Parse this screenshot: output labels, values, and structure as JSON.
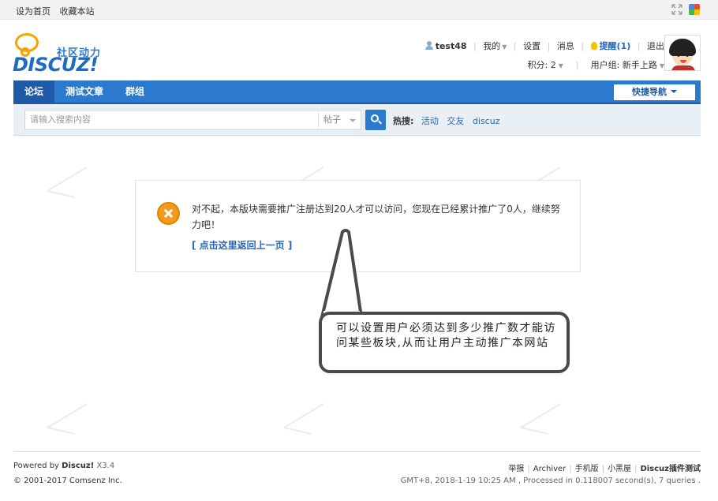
{
  "topbar": {
    "set_home": "设为首页",
    "bookmark": "收藏本站"
  },
  "logo": {
    "tagline": "社区动力",
    "wordmark": "DISCUZ!"
  },
  "user": {
    "name": "test48",
    "mine": "我的",
    "settings": "设置",
    "messages": "消息",
    "remind": "提醒(1)",
    "logout": "退出",
    "points": "积分: 2",
    "group": "用户组: 新手上路"
  },
  "nav": {
    "tabs": [
      "论坛",
      "测试文章",
      "群组"
    ],
    "quick_nav": "快捷导航"
  },
  "search": {
    "placeholder": "请输入搜索内容",
    "type": "帖子",
    "hot_label": "热搜:",
    "hot_keywords": [
      "活动",
      "交友",
      "discuz"
    ]
  },
  "message": {
    "text": "对不起，本版块需要推广注册达到20人才可以访问，您现在已经累计推广了0人，继续努力吧！",
    "back_link": "[ 点击这里返回上一页 ]"
  },
  "callout": {
    "text": "可以设置用户必须达到多少推广数才能访问某些板块,从而让用户主动推广本网站"
  },
  "footer": {
    "powered_prefix": "Powered by",
    "powered_name": "Discuz!",
    "version": "X3.4",
    "copyright": "© 2001-2017 Comsenz Inc.",
    "links": [
      "举报",
      "Archiver",
      "手机版",
      "小黑屋"
    ],
    "site_name": "Discuz插件测试",
    "stats": "GMT+8, 2018-1-19 10:25 AM , Processed in 0.118007 second(s), 7 queries ."
  },
  "colors": {
    "brand_blue": "#2b7acd",
    "nav_active": "#1e5aa5",
    "link_blue": "#2b66b7",
    "error_orange": "#f39a1e"
  }
}
